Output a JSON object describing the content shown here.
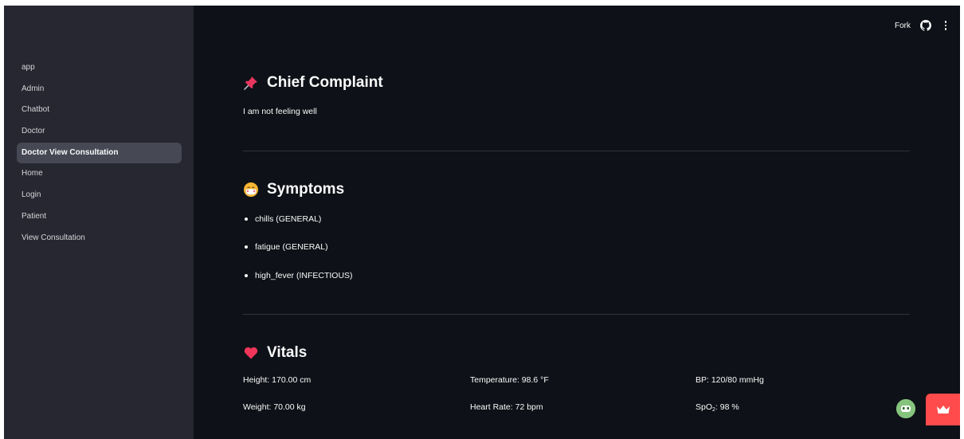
{
  "sidebar": {
    "items": [
      {
        "label": "app"
      },
      {
        "label": "Admin"
      },
      {
        "label": "Chatbot"
      },
      {
        "label": "Doctor"
      },
      {
        "label": "Doctor View Consultation",
        "active": true
      },
      {
        "label": "Home"
      },
      {
        "label": "Login"
      },
      {
        "label": "Patient"
      },
      {
        "label": "View Consultation"
      }
    ]
  },
  "toolbar": {
    "fork_label": "Fork",
    "github_icon": "github-icon",
    "menu_icon": "kebab-menu-icon"
  },
  "chief_complaint": {
    "icon": "pushpin-icon",
    "title": "Chief Complaint",
    "text": "I am not feeling well"
  },
  "symptoms": {
    "icon": "face-with-mask-icon",
    "title": "Symptoms",
    "items": [
      "chills (GENERAL)",
      "fatigue (GENERAL)",
      "high_fever (INFECTIOUS)"
    ]
  },
  "vitals": {
    "icon": "heart-icon",
    "title": "Vitals",
    "height": "Height: 170.00 cm",
    "weight": "Weight: 70.00 kg",
    "temperature": "Temperature: 98.6 °F",
    "heart_rate": "Heart Rate: 72 bpm",
    "bp": "BP: 120/80 mmHg",
    "spo2_prefix": "SpO",
    "spo2_sub": "2",
    "spo2_value": ": 98 %"
  },
  "colors": {
    "sidebar_bg": "#262730",
    "main_bg": "#0e1117",
    "accent": "#ff4b4b",
    "active_item": "#464854"
  }
}
